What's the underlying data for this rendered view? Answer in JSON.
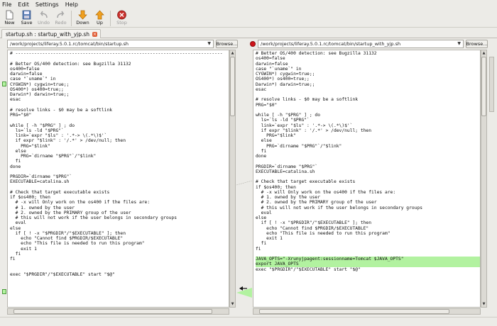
{
  "menu": [
    "File",
    "Edit",
    "Settings",
    "Help"
  ],
  "toolbar": {
    "new": "New",
    "save": "Save",
    "undo": "Undo",
    "redo": "Redo",
    "down": "Down",
    "up": "Up",
    "stop": "Stop"
  },
  "tab": {
    "label": "startup.sh : startup_with_yjp.sh"
  },
  "left": {
    "path": "/work/projects/liferay.5.0.1.rc/tomcat/bin/startup.sh",
    "browse": "Browse...",
    "lines": [
      "# -----------------------------------------------------------------------------",
      "",
      "# Better OS/400 detection: see Bugzilla 31132",
      "os400=false",
      "darwin=false",
      "case \"`uname`\" in",
      "CYGWIN*) cygwin=true;;",
      "OS400*) os400=true;;",
      "Darwin*) darwin=true;;",
      "esac",
      "",
      "# resolve links - $0 may be a softlink",
      "PRG=\"$0\"",
      "",
      "while [ -h \"$PRG\" ] ; do",
      "  ls=`ls -ld \"$PRG\"`",
      "  link=`expr \"$ls\" : '.*-> \\(.*\\)$'`",
      "  if expr \"$link\" : '/.*' > /dev/null; then",
      "    PRG=\"$link\"",
      "  else",
      "    PRG=`dirname \"$PRG\"`/\"$link\"",
      "  fi",
      "done",
      "",
      "PRGDIR=`dirname \"$PRG\"`",
      "EXECUTABLE=catalina.sh",
      "",
      "# Check that target executable exists",
      "if $os400; then",
      "  # -x will Only work on the os400 if the files are:",
      "  # 1. owned by the user",
      "  # 2. owned by the PRIMARY group of the user",
      "  # this will not work if the user belongs in secondary groups",
      "  eval",
      "else",
      "  if [ ! -x \"$PRGDIR\"/\"$EXECUTABLE\" ]; then",
      "    echo \"Cannot find $PRGDIR/$EXECUTABLE\"",
      "    echo \"This file is needed to run this program\"",
      "    exit 1",
      "  fi",
      "fi",
      "",
      "",
      "exec \"$PRGDIR\"/\"$EXECUTABLE\" start \"$@\""
    ]
  },
  "right": {
    "path": "/work/projects/liferay.5.0.1.rc/tomcat/bin/startup_with_yjp.sh",
    "browse": "Browse...",
    "lines": [
      "# Better OS/400 detection: see Bugzilla 31132",
      "os400=false",
      "darwin=false",
      "case \"`uname`\" in",
      "CYGWIN*) cygwin=true;;",
      "OS400*) os400=true;;",
      "Darwin*) darwin=true;;",
      "esac",
      "",
      "# resolve links - $0 may be a softlink",
      "PRG=\"$0\"",
      "",
      "while [ -h \"$PRG\" ] ; do",
      "  ls=`ls -ld \"$PRG\"`",
      "  link=`expr \"$ls\" : '.*-> \\(.*\\)$'`",
      "  if expr \"$link\" : '/.*' > /dev/null; then",
      "    PRG=\"$link\"",
      "  else",
      "    PRG=`dirname \"$PRG\"`/\"$link\"",
      "  fi",
      "done",
      "",
      "PRGDIR=`dirname \"$PRG\"`",
      "EXECUTABLE=catalina.sh",
      "",
      "# Check that target executable exists",
      "if $os400; then",
      "  # -x will Only work on the os400 if the files are:",
      "  # 1. owned by the user",
      "  # 2. owned by the PRIMARY group of the user",
      "  # this will not work if the user belongs in secondary groups",
      "  eval",
      "else",
      "  if [ ! -x \"$PRGDIR\"/\"$EXECUTABLE\" ]; then",
      "    echo \"Cannot find $PRGDIR/$EXECUTABLE\"",
      "    echo \"This file is needed to run this program\"",
      "    exit 1",
      "  fi",
      "fi",
      "",
      "JAVA_OPTS=\"-Xrunyjpagent:sessionname=Tomcat $JAVA_OPTS\"",
      "export JAVA_OPTS",
      "exec \"$PRGDIR\"/\"$EXECUTABLE\" start \"$@\""
    ],
    "highlight_from": 40,
    "highlight_to": 41
  },
  "colors": {
    "insert_highlight": "#b2f2a0",
    "stop_icon": "#c9302c",
    "arrow_icon": "#f0a020"
  }
}
